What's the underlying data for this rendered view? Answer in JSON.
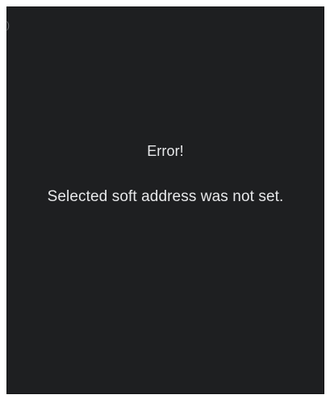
{
  "dialog": {
    "title": "Error!",
    "message": "Selected soft address was not set."
  },
  "screen": {
    "edge_glyph": ")"
  },
  "colors": {
    "background": "#1e1f21",
    "text": "#e7e8ea",
    "border": "#ffffff"
  }
}
